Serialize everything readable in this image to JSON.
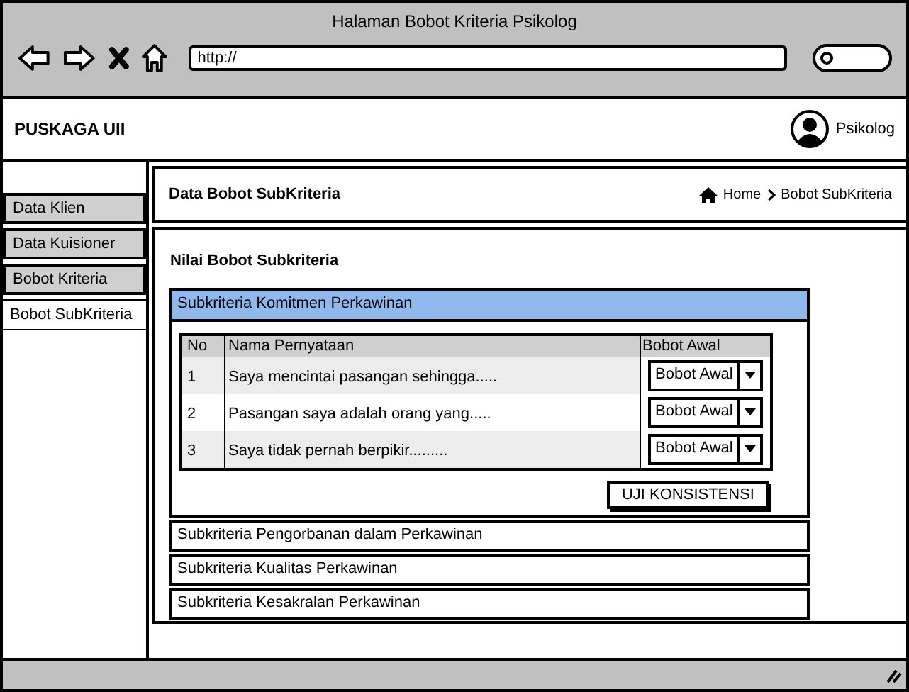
{
  "window": {
    "title": "Halaman Bobot Kriteria Psikolog",
    "url": "http://"
  },
  "header": {
    "brand": "PUSKAGA UII",
    "user": "Psikolog"
  },
  "sidebar": {
    "items": [
      {
        "label": "Data Klien",
        "selected": false
      },
      {
        "label": "Data Kuisioner",
        "selected": false
      },
      {
        "label": "Bobot Kriteria",
        "selected": false
      },
      {
        "label": "Bobot SubKriteria",
        "selected": true
      }
    ]
  },
  "page": {
    "title": "Data Bobot SubKriteria",
    "breadcrumb": [
      "Home",
      "Bobot SubKriteria"
    ]
  },
  "panel": {
    "title": "Nilai Bobot Subkriteria",
    "sections": [
      {
        "title": "Subkriteria Komitmen Perkawinan",
        "expanded": true,
        "table": {
          "columns": [
            "No",
            "Nama Pernyataan",
            "Bobot Awal"
          ],
          "rows": [
            {
              "no": "1",
              "statement": "Saya mencintai pasangan sehingga.....",
              "weight": "Bobot Awal"
            },
            {
              "no": "2",
              "statement": "Pasangan saya adalah orang yang.....",
              "weight": "Bobot Awal"
            },
            {
              "no": "3",
              "statement": "Saya tidak pernah berpikir.........",
              "weight": "Bobot Awal"
            }
          ]
        },
        "button": "UJI KONSISTENSI"
      },
      {
        "title": "Subkriteria Pengorbanan dalam Perkawinan",
        "expanded": false
      },
      {
        "title": "Subkriteria Kualitas Perkawinan",
        "expanded": false
      },
      {
        "title": "Subkriteria Kesakralan Perkawinan",
        "expanded": false
      }
    ]
  }
}
